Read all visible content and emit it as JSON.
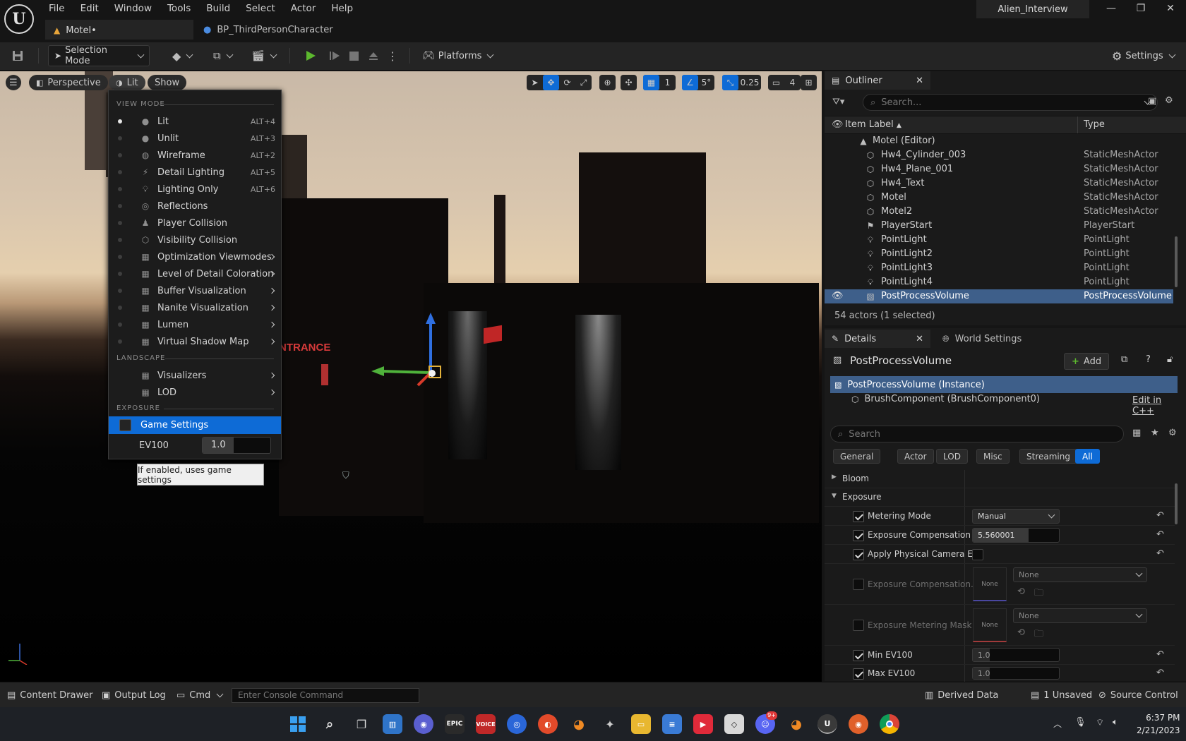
{
  "app": {
    "logo": "U",
    "project_name": "Alien_Interview",
    "menus": [
      "File",
      "Edit",
      "Window",
      "Tools",
      "Build",
      "Select",
      "Actor",
      "Help"
    ],
    "tabs": [
      {
        "label": "Motel•",
        "icon": "level-icon"
      },
      {
        "label": "BP_ThirdPersonCharacter",
        "icon": "blueprint-icon"
      }
    ],
    "window_controls": {
      "minimize": "—",
      "maximize": "❐",
      "close": "✕"
    }
  },
  "toolbar": {
    "selection_mode": "Selection Mode",
    "platforms": "Platforms",
    "settings": "Settings"
  },
  "viewport": {
    "perspective": "Perspective",
    "lit": "Lit",
    "show": "Show",
    "grid_snap": "1",
    "rotation_snap": "5°",
    "scale_snap": "0.25",
    "camera_speed": "4",
    "scene_sign": "NTRANCE"
  },
  "view_menu": {
    "section_view_mode": "VIEW MODE",
    "items": [
      {
        "label": "Lit",
        "shortcut": "ALT+4",
        "selected": true,
        "icon": "lit-sphere-icon"
      },
      {
        "label": "Unlit",
        "shortcut": "ALT+3",
        "icon": "unlit-sphere-icon"
      },
      {
        "label": "Wireframe",
        "shortcut": "ALT+2",
        "icon": "wireframe-icon"
      },
      {
        "label": "Detail Lighting",
        "shortcut": "ALT+5",
        "icon": "detail-lighting-icon"
      },
      {
        "label": "Lighting Only",
        "shortcut": "ALT+6",
        "icon": "bulb-icon"
      },
      {
        "label": "Reflections",
        "icon": "reflections-icon"
      },
      {
        "label": "Player Collision",
        "icon": "player-collision-icon"
      },
      {
        "label": "Visibility Collision",
        "icon": "visibility-collision-icon"
      },
      {
        "label": "Optimization Viewmodes",
        "submenu": true,
        "icon": "grid-icon"
      },
      {
        "label": "Level of Detail Coloration",
        "submenu": true,
        "icon": "grid-icon"
      },
      {
        "label": "Buffer Visualization",
        "submenu": true,
        "icon": "grid-icon"
      },
      {
        "label": "Nanite Visualization",
        "submenu": true,
        "icon": "grid-icon"
      },
      {
        "label": "Lumen",
        "submenu": true,
        "icon": "grid-icon"
      },
      {
        "label": "Virtual Shadow Map",
        "submenu": true,
        "icon": "grid-icon"
      }
    ],
    "section_landscape": "LANDSCAPE",
    "landscape_items": [
      {
        "label": "Visualizers",
        "submenu": true
      },
      {
        "label": "LOD",
        "submenu": true
      }
    ],
    "section_exposure": "EXPOSURE",
    "game_settings": "Game Settings",
    "ev100_label": "EV100",
    "ev100_value": "1.0",
    "tooltip": "If enabled, uses game settings"
  },
  "outliner": {
    "title": "Outliner",
    "search_placeholder": "Search...",
    "col_label": "Item Label",
    "col_type": "Type",
    "root": "Motel (Editor)",
    "rows": [
      {
        "label": "Hw4_Cylinder_003",
        "type": "StaticMeshActor",
        "icon": "static-mesh-icon"
      },
      {
        "label": "Hw4_Plane_001",
        "type": "StaticMeshActor",
        "icon": "static-mesh-icon"
      },
      {
        "label": "Hw4_Text",
        "type": "StaticMeshActor",
        "icon": "static-mesh-icon"
      },
      {
        "label": "Motel",
        "type": "StaticMeshActor",
        "icon": "static-mesh-icon"
      },
      {
        "label": "Motel2",
        "type": "StaticMeshActor",
        "icon": "static-mesh-icon"
      },
      {
        "label": "PlayerStart",
        "type": "PlayerStart",
        "icon": "player-start-icon"
      },
      {
        "label": "PointLight",
        "type": "PointLight",
        "icon": "bulb-icon"
      },
      {
        "label": "PointLight2",
        "type": "PointLight",
        "icon": "bulb-icon"
      },
      {
        "label": "PointLight3",
        "type": "PointLight",
        "icon": "bulb-icon"
      },
      {
        "label": "PointLight4",
        "type": "PointLight",
        "icon": "bulb-icon"
      },
      {
        "label": "PostProcessVolume",
        "type": "PostProcessVolume",
        "icon": "volume-icon",
        "selected": true
      }
    ],
    "status": "54 actors (1 selected)"
  },
  "details": {
    "tab_details": "Details",
    "tab_world": "World Settings",
    "actor_name": "PostProcessVolume",
    "add_label": "Add",
    "instance": "PostProcessVolume (Instance)",
    "component": "BrushComponent (BrushComponent0)",
    "edit_cpp": "Edit in C++",
    "search_placeholder": "Search",
    "filters": [
      "General",
      "Actor",
      "LOD",
      "Misc",
      "Streaming",
      "All"
    ],
    "active_filter": "All",
    "sections": {
      "bloom": "Bloom",
      "exposure": "Exposure"
    },
    "props": {
      "metering_mode": {
        "label": "Metering Mode",
        "value": "Manual"
      },
      "exposure_comp": {
        "label": "Exposure Compensation",
        "value": "5.560001"
      },
      "apply_physical": {
        "label": "Apply Physical Camera E..."
      },
      "exposure_comp_curve": {
        "label": "Exposure Compensation...",
        "thumb": "None",
        "value": "None"
      },
      "metering_mask": {
        "label": "Exposure Metering Mask",
        "thumb": "None",
        "value": "None"
      },
      "min_ev100": {
        "label": "Min EV100",
        "value": "1.0"
      },
      "max_ev100": {
        "label": "Max EV100",
        "value": "1.0"
      }
    }
  },
  "bottom": {
    "content_drawer": "Content Drawer",
    "output_log": "Output Log",
    "cmd": "Cmd",
    "console_placeholder": "Enter Console Command",
    "derived_data": "Derived Data",
    "unsaved": "1 Unsaved",
    "source_control": "Source Control"
  },
  "taskbar": {
    "time": "6:37 PM",
    "date": "2/21/2023",
    "epic_label": "EPIC",
    "voice_label": "VOICE",
    "discord_badge": "9+"
  },
  "colors": {
    "accent": "#0e6bd6",
    "selection": "#3e5f8a"
  }
}
